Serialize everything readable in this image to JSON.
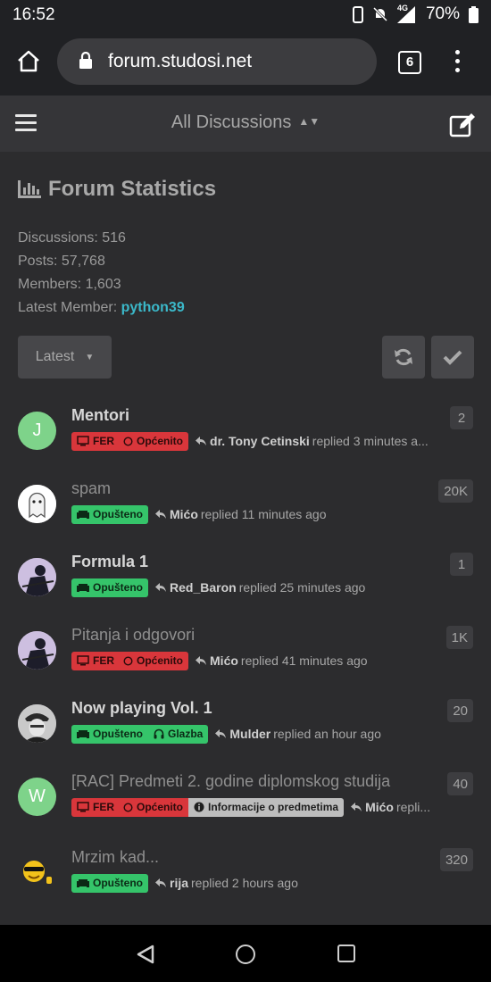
{
  "status_bar": {
    "time": "16:52",
    "network": "4G",
    "battery": "70%"
  },
  "browser": {
    "url": "forum.studosi.net",
    "tab_count": "6"
  },
  "header": {
    "title": "All Discussions"
  },
  "stats": {
    "heading": "Forum Statistics",
    "discussions": "Discussions: 516",
    "posts": "Posts: 57,768",
    "members": "Members: 1,603",
    "latest_member_label": "Latest Member:",
    "latest_member": "python39"
  },
  "controls": {
    "sort_label": "Latest"
  },
  "colors": {
    "tag_red": "#d9363b",
    "tag_green": "#35c46a",
    "tag_gray": "#bdbdbd",
    "link": "#3bb8c9"
  },
  "discussions": [
    {
      "title": "Mentori",
      "tags": [
        "FER",
        "Općenito"
      ],
      "user": "dr. Tony Cetinski",
      "action": "replied 3 minutes a...",
      "count": "2"
    },
    {
      "title": "spam",
      "tags": [
        "Opušteno"
      ],
      "user": "Mićo",
      "action": "replied 11 minutes ago",
      "count": "20K"
    },
    {
      "title": "Formula 1",
      "tags": [
        "Opušteno"
      ],
      "user": "Red_Baron",
      "action": "replied 25 minutes ago",
      "count": "1"
    },
    {
      "title": "Pitanja i odgovori",
      "tags": [
        "FER",
        "Općenito"
      ],
      "user": "Mićo",
      "action": "replied 41 minutes ago",
      "count": "1K"
    },
    {
      "title": "Now playing Vol. 1",
      "tags": [
        "Opušteno",
        "Glazba"
      ],
      "user": "Mulder",
      "action": "replied an hour ago",
      "count": "20"
    },
    {
      "title": "[RAC] Predmeti 2. godine diplomskog studija",
      "tags": [
        "FER",
        "Općenito",
        "Informacije o predmetima"
      ],
      "user": "Mićo",
      "action": "repli...",
      "count": "40"
    },
    {
      "title": "Mrzim kad...",
      "tags": [
        "Opušteno"
      ],
      "user": "rija",
      "action": "replied 2 hours ago",
      "count": "320"
    }
  ],
  "avatars": {
    "mentori": "J",
    "rac": "W"
  }
}
